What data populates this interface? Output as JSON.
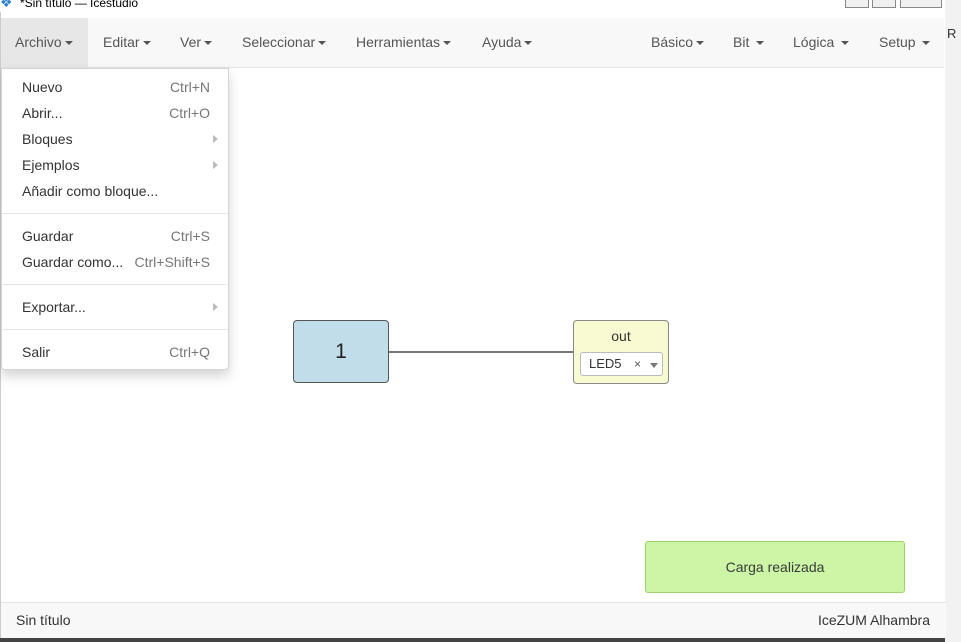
{
  "window": {
    "title": "*Sin título — Icestudio",
    "right_edge_letter": "R"
  },
  "navbar": {
    "left_menus": [
      {
        "label": "Archivo"
      },
      {
        "label": "Editar"
      },
      {
        "label": "Ver"
      },
      {
        "label": "Seleccionar"
      },
      {
        "label": "Herramientas"
      },
      {
        "label": "Ayuda"
      }
    ],
    "right_menus": [
      {
        "label": "Básico"
      },
      {
        "label": "Bit"
      },
      {
        "label": "Lógica"
      },
      {
        "label": "Setup"
      }
    ]
  },
  "archivo_menu": {
    "items": [
      {
        "label": "Nuevo",
        "shortcut": "Ctrl+N"
      },
      {
        "label": "Abrir...",
        "shortcut": "Ctrl+O"
      },
      {
        "label": "Bloques",
        "shortcut": ""
      },
      {
        "label": "Ejemplos",
        "shortcut": ""
      },
      {
        "label": "Añadir como bloque...",
        "shortcut": ""
      },
      {
        "label": "Guardar",
        "shortcut": "Ctrl+S"
      },
      {
        "label": "Guardar como...",
        "shortcut": "Ctrl+Shift+S"
      },
      {
        "label": "Exportar...",
        "shortcut": ""
      },
      {
        "label": "Salir",
        "shortcut": "Ctrl+Q"
      }
    ]
  },
  "canvas": {
    "constant_block": {
      "value": "1"
    },
    "output_block": {
      "name": "out",
      "pin": "LED5",
      "clear_glyph": "×"
    }
  },
  "toast": {
    "message": "Carga realizada"
  },
  "footer": {
    "left": "Sin título",
    "right": "IceZUM Alhambra"
  },
  "colors": {
    "constant_block": "#c0dde9",
    "output_block": "#fafad2",
    "toast": "#ccf5a5"
  }
}
